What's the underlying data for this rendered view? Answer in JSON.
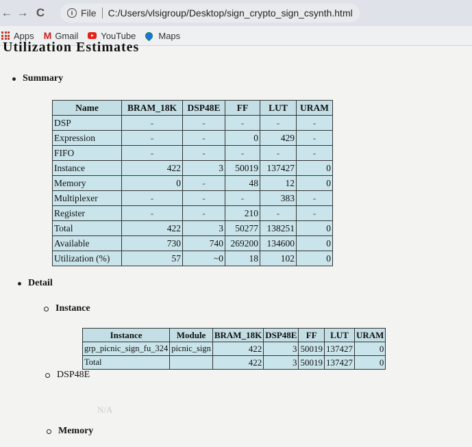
{
  "browser": {
    "file_label": "File",
    "url": "C:/Users/vlsigroup/Desktop/sign_crypto_sign_csynth.html",
    "nav_icons": [
      "back-icon",
      "forward-icon",
      "reload-icon",
      "info-icon"
    ]
  },
  "bookmarks": [
    {
      "label": "Apps",
      "icon": "apps-icon"
    },
    {
      "label": "Gmail",
      "icon": "gmail-icon"
    },
    {
      "label": "YouTube",
      "icon": "youtube-icon"
    },
    {
      "label": "Maps",
      "icon": "maps-icon"
    }
  ],
  "page": {
    "heading": "Utilization Estimates",
    "summary_label": "Summary",
    "detail_label": "Detail",
    "instance_label": "Instance",
    "dsp_label": "DSP48E",
    "dsp_value": "N/A",
    "memory_label": "Memory"
  },
  "summary": {
    "headers": [
      "Name",
      "BRAM_18K",
      "DSP48E",
      "FF",
      "LUT",
      "URAM"
    ],
    "rows": [
      [
        "DSP",
        "-",
        "-",
        "-",
        "-",
        "-"
      ],
      [
        "Expression",
        "-",
        "-",
        "0",
        "429",
        "-"
      ],
      [
        "FIFO",
        "-",
        "-",
        "-",
        "-",
        "-"
      ],
      [
        "Instance",
        "422",
        "3",
        "50019",
        "137427",
        "0"
      ],
      [
        "Memory",
        "0",
        "-",
        "48",
        "12",
        "0"
      ],
      [
        "Multiplexer",
        "-",
        "-",
        "-",
        "383",
        "-"
      ],
      [
        "Register",
        "-",
        "-",
        "210",
        "-",
        "-"
      ],
      [
        "Total",
        "422",
        "3",
        "50277",
        "138251",
        "0"
      ],
      [
        "Available",
        "730",
        "740",
        "269200",
        "134600",
        "0"
      ],
      [
        "Utilization (%)",
        "57",
        "~0",
        "18",
        "102",
        "0"
      ]
    ]
  },
  "instance": {
    "headers": [
      "Instance",
      "Module",
      "BRAM_18K",
      "DSP48E",
      "FF",
      "LUT",
      "URAM"
    ],
    "rows": [
      [
        "grp_picnic_sign_fu_324",
        "picnic_sign",
        "422",
        "3",
        "50019",
        "137427",
        "0"
      ],
      [
        "Total",
        "",
        "422",
        "3",
        "50019",
        "137427",
        "0"
      ]
    ]
  }
}
